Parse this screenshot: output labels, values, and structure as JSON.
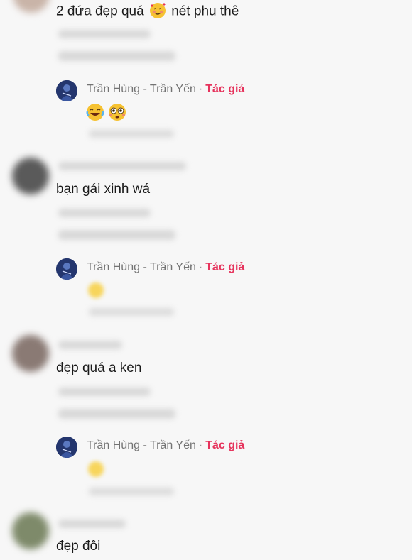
{
  "comments": [
    {
      "text": "2 đứa đẹp quá",
      "text_after_emoji": "nét phu thê",
      "emoji": "smiling-face-with-hearts",
      "reply": {
        "name": "Trần Hùng - Trần Yến",
        "separator": "·",
        "author_tag": "Tác giả",
        "emoji": "laughing-and-flushed"
      }
    },
    {
      "text": "bạn gái xinh wá",
      "reply": {
        "name": "Trần Hùng - Trần Yến",
        "separator": "·",
        "author_tag": "Tác giả",
        "emoji": "blurred-smiley"
      }
    },
    {
      "text": "đẹp quá a ken",
      "reply": {
        "name": "Trần Hùng - Trần Yến",
        "separator": "·",
        "author_tag": "Tác giả",
        "emoji": "blurred-smiley"
      }
    },
    {
      "text": "đẹp đôi"
    }
  ],
  "colors": {
    "background": "#f7f7f7",
    "author_tag": "#e6335c",
    "reply_name": "#737373",
    "comment_text": "#1a1a1a"
  }
}
